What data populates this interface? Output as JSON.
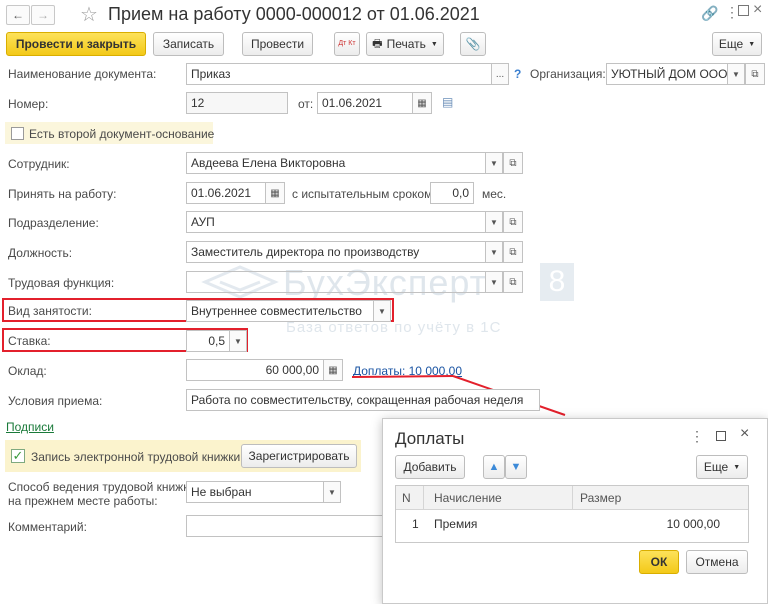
{
  "header": {
    "back_icon": "arrow-left-icon",
    "forward_icon": "arrow-right-icon",
    "star_icon": "star-icon",
    "title": "Прием на работу 0000-000012 от 01.06.2021",
    "link_icon": "link-icon",
    "menu_icon": "kebab-icon",
    "maximize_icon": "maximize-icon",
    "close_icon": "close-icon"
  },
  "toolbar": {
    "post_close": "Провести и закрыть",
    "save": "Записать",
    "post": "Провести",
    "dt_kt": "Дт Кт",
    "print": "Печать",
    "more": "Еще"
  },
  "form": {
    "doc_name_label": "Наименование документа:",
    "doc_name_value": "Приказ",
    "doc_name_dots": "...",
    "help": "?",
    "org_label": "Организация:",
    "org_value": "УЮТНЫЙ ДОМ ООО",
    "number_label": "Номер:",
    "number_value": "12",
    "date_from_label": "от:",
    "date_value": "01.06.2021",
    "second_doc_label": "Есть второй документ-основание",
    "employee_label": "Сотрудник:",
    "employee_value": "Авдеева Елена Викторовна",
    "hire_label": "Принять на работу:",
    "hire_date": "01.06.2021",
    "probation_label": "с испытательным сроком:",
    "probation_value": "0,0",
    "probation_unit": "мес.",
    "dept_label": "Подразделение:",
    "dept_value": "АУП",
    "position_label": "Должность:",
    "position_value": "Заместитель директора по производству",
    "labor_func_label": "Трудовая функция:",
    "labor_func_value": "",
    "employment_label": "Вид занятости:",
    "employment_value": "Внутреннее совместительство",
    "rate_label": "Ставка:",
    "rate_value": "0,5",
    "salary_label": "Оклад:",
    "salary_value": "60 000,00",
    "extras_link": "Доплаты: 10 000,00",
    "conditions_label": "Условия приема:",
    "conditions_value": "Работа по совместительству, сокращенная рабочая неделя",
    "signatures_link": "Подписи",
    "elec_book_label": "Запись электронной трудовой книжки:",
    "register_button": "Зарегистрировать",
    "book_method_label_1": "Способ ведения трудовой книжки",
    "book_method_label_2": "на прежнем месте работы:",
    "book_method_value": "Не выбран",
    "comment_label": "Комментарий:",
    "comment_value": ""
  },
  "watermark": {
    "title": "БухЭксперт",
    "digit": "8",
    "subtitle": "База ответов по учёту в 1С"
  },
  "dialog": {
    "title": "Доплаты",
    "add_button": "Добавить",
    "more": "Еще",
    "columns": [
      "N",
      "Начисление",
      "Размер"
    ],
    "rows": [
      {
        "n": "1",
        "accrual": "Премия",
        "amount": "10 000,00"
      }
    ],
    "ok": "ОК",
    "cancel": "Отмена"
  },
  "colors": {
    "accent_yellow": "#f5cb1e",
    "highlight_red": "#e3202c",
    "link_blue": "#1a54a3",
    "check_green": "#3a9a3a"
  }
}
